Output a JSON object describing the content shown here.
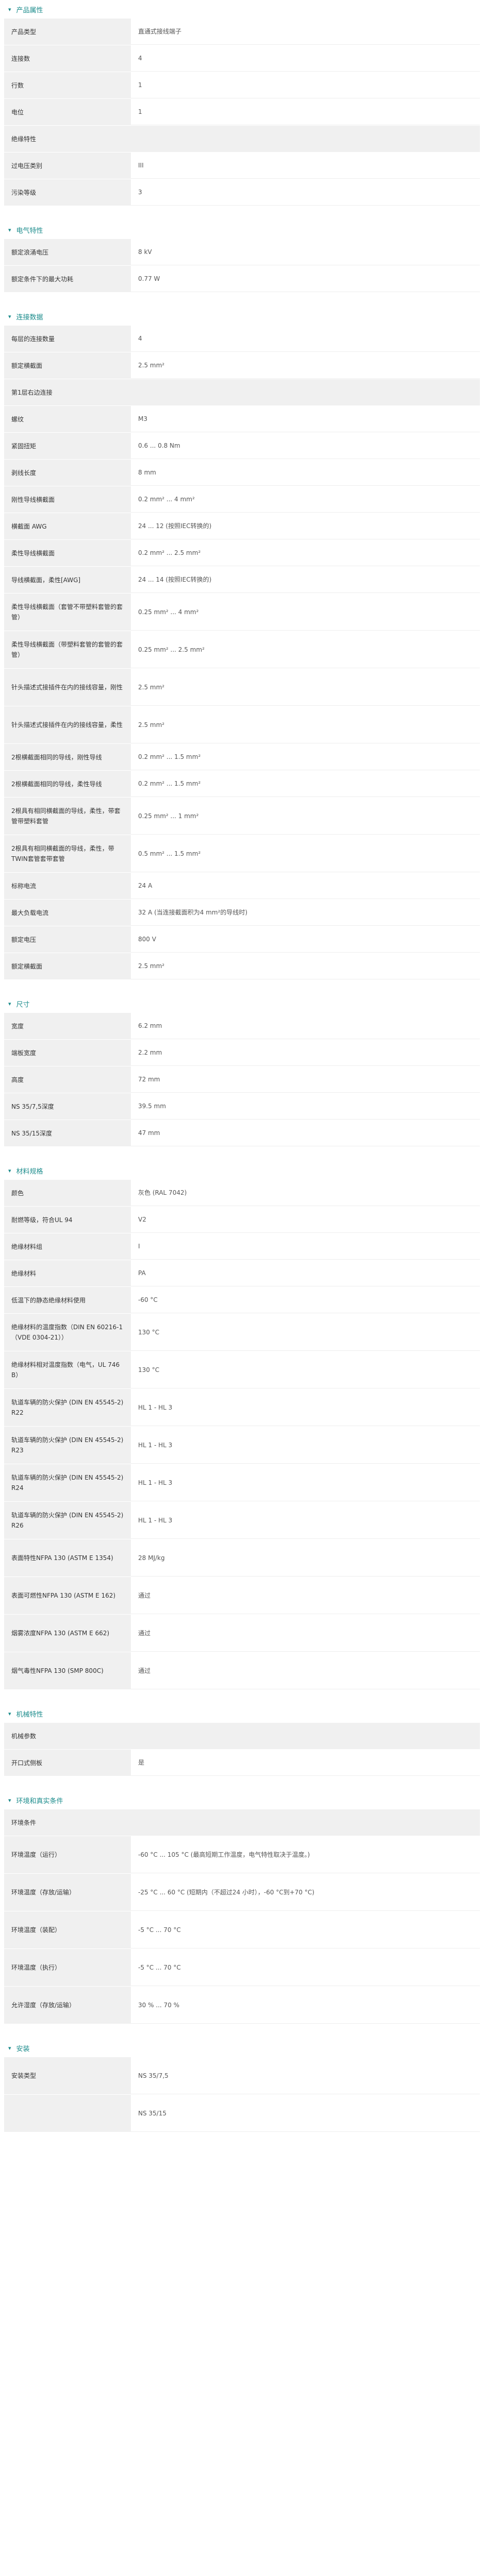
{
  "sections": [
    {
      "title": "产品属性",
      "rows": [
        {
          "type": "row",
          "label": "产品类型",
          "value": "直通式接线端子"
        },
        {
          "type": "row",
          "label": "连接数",
          "value": "4"
        },
        {
          "type": "row",
          "label": "行数",
          "value": "1"
        },
        {
          "type": "row",
          "label": "电位",
          "value": "1"
        },
        {
          "type": "sub",
          "label": "绝缘特性"
        },
        {
          "type": "row",
          "label": "过电压类别",
          "value": "III"
        },
        {
          "type": "row",
          "label": "污染等级",
          "value": "3"
        }
      ]
    },
    {
      "title": "电气特性",
      "rows": [
        {
          "type": "row",
          "label": "额定浪涌电压",
          "value": "8 kV"
        },
        {
          "type": "row",
          "label": "额定条件下的最大功耗",
          "value": "0.77 W"
        }
      ]
    },
    {
      "title": "连接数据",
      "rows": [
        {
          "type": "row",
          "label": "每层的连接数量",
          "value": "4"
        },
        {
          "type": "row",
          "label": "额定横截面",
          "value": "2.5 mm²"
        },
        {
          "type": "sub",
          "label": "第1层右边连接"
        },
        {
          "type": "row",
          "label": "螺纹",
          "value": "M3"
        },
        {
          "type": "row",
          "label": "紧固扭矩",
          "value": "0.6 ... 0.8 Nm"
        },
        {
          "type": "row",
          "label": "剥线长度",
          "value": "8 mm"
        },
        {
          "type": "row",
          "label": "刚性导线横截面",
          "value": "0.2 mm² ... 4 mm²"
        },
        {
          "type": "row",
          "label": "横截面 AWG",
          "value": "24 ... 12 (按照IEC转换的)"
        },
        {
          "type": "row",
          "label": "柔性导线横截面",
          "value": "0.2 mm² ... 2.5 mm²"
        },
        {
          "type": "row",
          "label": "导线横截面，柔性[AWG]",
          "value": "24 ... 14 (按照IEC转换的)"
        },
        {
          "type": "row",
          "label": "柔性导线横截面（套管不带塑料套管的套管）",
          "value": "0.25 mm² ... 4 mm²",
          "h": "tall"
        },
        {
          "type": "row",
          "label": "柔性导线横截面（带塑料套管的套管的套管）",
          "value": "0.25 mm² ... 2.5 mm²",
          "h": "tall"
        },
        {
          "type": "row",
          "label": "针头描述式接插件在内的接线容量，刚性",
          "value": "2.5 mm²",
          "h": "tall"
        },
        {
          "type": "row",
          "label": "针头描述式接插件在内的接线容量，柔性",
          "value": "2.5 mm²",
          "h": "tall"
        },
        {
          "type": "row",
          "label": "2根横截面相同的导线，刚性导线",
          "value": "0.2 mm² ... 1.5 mm²"
        },
        {
          "type": "row",
          "label": "2根横截面相同的导线，柔性导线",
          "value": "0.2 mm² ... 1.5 mm²"
        },
        {
          "type": "row",
          "label": "2根具有相同横截面的导线，柔性，带套管带塑料套管",
          "value": "0.25 mm² ... 1 mm²",
          "h": "tall"
        },
        {
          "type": "row",
          "label": "2根具有相同横截面的导线，柔性，带TWIN套管套带套管",
          "value": "0.5 mm² ... 1.5 mm²",
          "h": "tall"
        },
        {
          "type": "row",
          "label": "标称电流",
          "value": "24 A"
        },
        {
          "type": "row",
          "label": "最大负载电流",
          "value": "32 A (当连接截面积为4 mm²的导线时)"
        },
        {
          "type": "row",
          "label": "额定电压",
          "value": "800 V"
        },
        {
          "type": "row",
          "label": "额定横截面",
          "value": "2.5 mm²"
        }
      ]
    },
    {
      "title": "尺寸",
      "rows": [
        {
          "type": "row",
          "label": "宽度",
          "value": "6.2 mm"
        },
        {
          "type": "row",
          "label": "端板宽度",
          "value": "2.2 mm"
        },
        {
          "type": "row",
          "label": "高度",
          "value": "72 mm"
        },
        {
          "type": "row",
          "label": "NS 35/7,5深度",
          "value": "39.5 mm"
        },
        {
          "type": "row",
          "label": "NS 35/15深度",
          "value": "47 mm"
        }
      ]
    },
    {
      "title": "材料规格",
      "rows": [
        {
          "type": "row",
          "label": "颜色",
          "value": "灰色 (RAL 7042)"
        },
        {
          "type": "row",
          "label": "耐燃等级，符合UL 94",
          "value": "V2"
        },
        {
          "type": "row",
          "label": "绝缘材料组",
          "value": "I"
        },
        {
          "type": "row",
          "label": "绝缘材料",
          "value": "PA"
        },
        {
          "type": "row",
          "label": "低温下的静态绝缘材料使用",
          "value": "-60 °C"
        },
        {
          "type": "row",
          "label": "绝缘材料的温度指数（DIN EN 60216-1（VDE 0304-21））",
          "value": "130 °C",
          "h": "tall"
        },
        {
          "type": "row",
          "label": "绝缘材料相对温度指数（电气，UL 746 B）",
          "value": "130 °C",
          "h": "tall"
        },
        {
          "type": "row",
          "label": "轨道车辆的防火保护 (DIN EN 45545-2) R22",
          "value": "HL 1 - HL 3",
          "h": "tall"
        },
        {
          "type": "row",
          "label": "轨道车辆的防火保护 (DIN EN 45545-2) R23",
          "value": "HL 1 - HL 3",
          "h": "tall"
        },
        {
          "type": "row",
          "label": "轨道车辆的防火保护 (DIN EN 45545-2) R24",
          "value": "HL 1 - HL 3",
          "h": "tall"
        },
        {
          "type": "row",
          "label": "轨道车辆的防火保护 (DIN EN 45545-2) R26",
          "value": "HL 1 - HL 3",
          "h": "tall"
        },
        {
          "type": "row",
          "label": "表面特性NFPA 130 (ASTM E 1354)",
          "value": "28 MJ/kg",
          "h": "tall"
        },
        {
          "type": "row",
          "label": "表面可燃性NFPA 130 (ASTM E 162)",
          "value": "通过",
          "h": "tall"
        },
        {
          "type": "row",
          "label": "烟雾浓度NFPA 130 (ASTM E 662)",
          "value": "通过",
          "h": "tall"
        },
        {
          "type": "row",
          "label": "烟气毒性NFPA 130 (SMP 800C)",
          "value": "通过",
          "h": "tall"
        }
      ]
    },
    {
      "title": "机械特性",
      "rows": [
        {
          "type": "sub",
          "label": "机械参数"
        },
        {
          "type": "row",
          "label": "开口式侧板",
          "value": "是"
        }
      ]
    },
    {
      "title": "环境和真实条件",
      "rows": [
        {
          "type": "sub",
          "label": "环境条件"
        },
        {
          "type": "row",
          "label": "环境温度（运行）",
          "value": "-60 °C ... 105 °C (最高短期工作温度，电气特性取决于温度。)",
          "h": "tall"
        },
        {
          "type": "row",
          "label": "环境温度（存放/运输）",
          "value": "-25 °C ... 60 °C (短期内（不超过24 小时），-60 °C到+70 °C)",
          "h": "tall"
        },
        {
          "type": "row",
          "label": "环境温度（装配）",
          "value": "-5 °C ... 70 °C",
          "h": "tall"
        },
        {
          "type": "row",
          "label": "环境温度（执行）",
          "value": "-5 °C ... 70 °C",
          "h": "tall"
        },
        {
          "type": "row",
          "label": "允许湿度（存放/运输）",
          "value": "30 % ... 70 %",
          "h": "tall"
        }
      ]
    },
    {
      "title": "安装",
      "rows": [
        {
          "type": "row",
          "label": "安装类型",
          "value": "NS 35/7,5",
          "h": "tall"
        },
        {
          "type": "row",
          "label": "",
          "value": "NS 35/15",
          "h": "tall"
        }
      ]
    }
  ]
}
